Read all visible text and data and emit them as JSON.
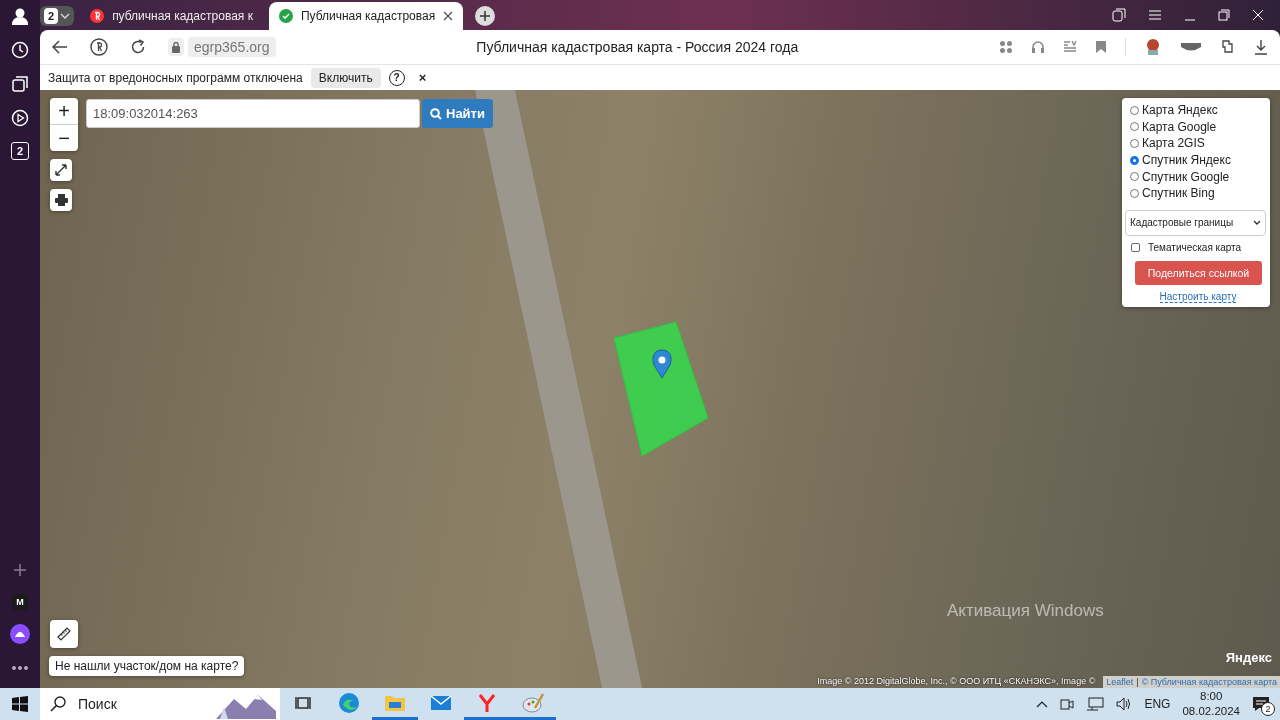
{
  "browser": {
    "tab_count": "2",
    "tabs": [
      {
        "kind": "yandex",
        "title": "публичная кадастровая к",
        "selected": false
      },
      {
        "kind": "secure",
        "title": "Публичная кадастровая",
        "selected": true
      }
    ],
    "address": "egrp365.org",
    "page_title": "Публичная кадастровая карта - Россия 2024 года"
  },
  "infobar": {
    "message": "Защита от вредоносных программ отключена",
    "button": "Включить",
    "help": "?",
    "close": "×"
  },
  "sidebar": {
    "badge": "2",
    "profile_letter": "M"
  },
  "map": {
    "zoom_in": "+",
    "zoom_out": "−",
    "search": {
      "value": "18:09:032014:263"
    },
    "search_button": "Найти",
    "layers": [
      {
        "label": "Карта Яндекс",
        "selected": false
      },
      {
        "label": "Карта Google",
        "selected": false
      },
      {
        "label": "Карта 2GIS",
        "selected": false
      },
      {
        "label": "Спутник Яндекс",
        "selected": true
      },
      {
        "label": "Спутник Google",
        "selected": false
      },
      {
        "label": "Спутник Bing",
        "selected": false
      }
    ],
    "overlay_select": "Кадастровые границы",
    "thematic": {
      "label": "Тематическая карта",
      "checked": false
    },
    "share_button": "Поделиться ссылкой",
    "settings_link": "Настроить карту",
    "not_found_button": "Не нашли участок/дом на карте?",
    "logo": "Яндекс",
    "attribution": "Image © 2012 DigitalGlobe, Inc., © ООО ИТЦ «СКАНЭКС», Image ©",
    "attribution_links": [
      "Leaflet",
      "© Публичная кадастровая карта"
    ],
    "separator": "|"
  },
  "os_watermark": "Активация Windows",
  "taskbar": {
    "search_placeholder": "Поиск",
    "apps": [
      {
        "kind": "taskview",
        "running": false
      },
      {
        "kind": "edge",
        "running": false
      },
      {
        "kind": "explorer",
        "running": true
      },
      {
        "kind": "mail",
        "running": false
      },
      {
        "kind": "yandex",
        "running": true
      },
      {
        "kind": "paint",
        "running": true
      }
    ],
    "language": "ENG",
    "time": "8:00",
    "date": "08.02.2024",
    "notification_count": "2"
  }
}
